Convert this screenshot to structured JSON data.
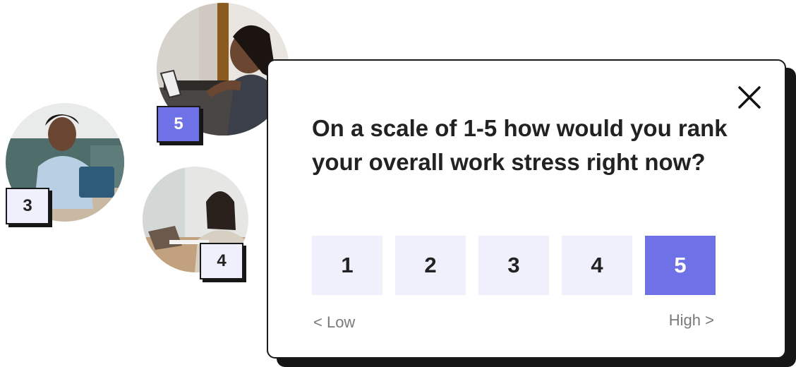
{
  "survey": {
    "question": "On a scale of 1-5 how would you rank your overall work stress right now?",
    "options": [
      "1",
      "2",
      "3",
      "4",
      "5"
    ],
    "selected": "5",
    "low_label": "< Low",
    "high_label": "High >"
  },
  "participants": [
    {
      "rating": "5",
      "description": "woman using laptop at standing desk"
    },
    {
      "rating": "3",
      "description": "man with laptop on sofa"
    },
    {
      "rating": "4",
      "description": "woman smiling at laptop"
    }
  ],
  "colors": {
    "accent": "#6f72e6",
    "option_bg": "#eff0fb",
    "text": "#222222",
    "muted": "#7a7a7a"
  },
  "icons": {
    "close": "close-icon"
  }
}
